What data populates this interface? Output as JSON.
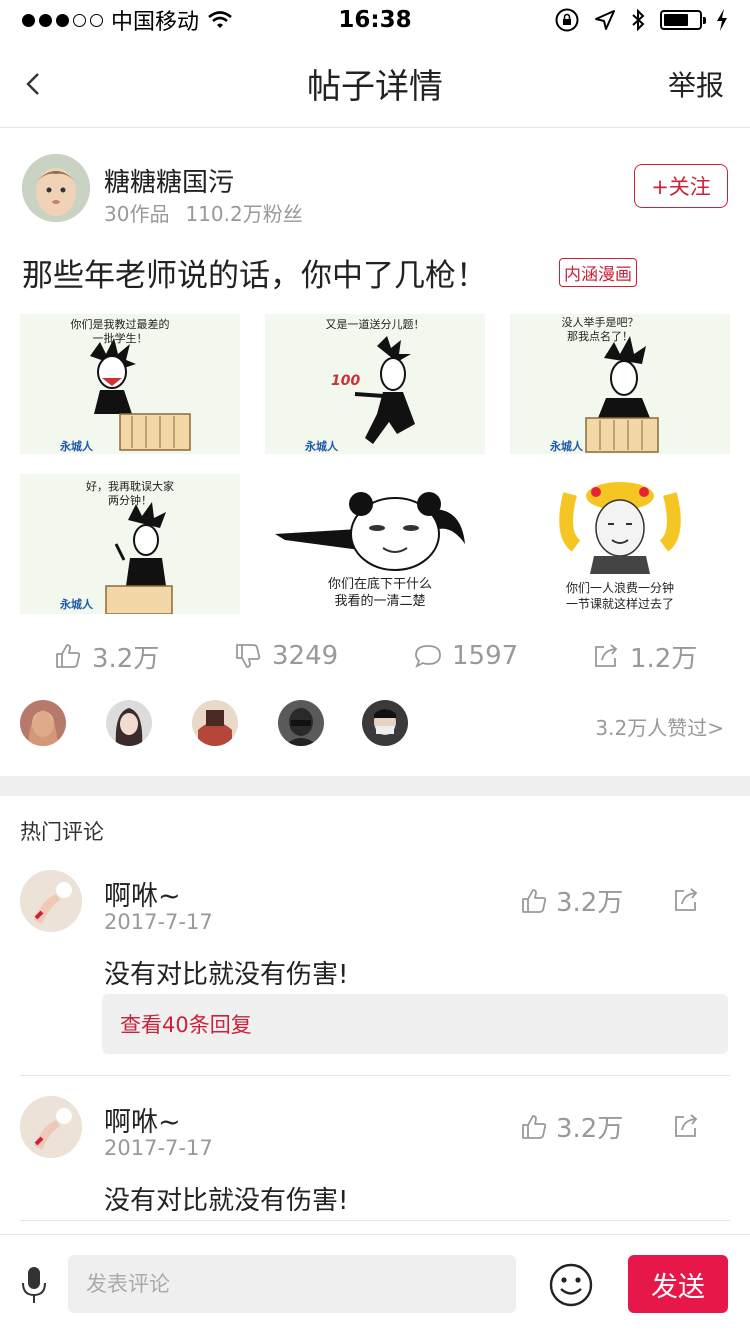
{
  "status": {
    "carrier": "中国移动",
    "time": "16:38",
    "battery_level": 0.7
  },
  "nav": {
    "title": "帖子详情",
    "report": "举报"
  },
  "author": {
    "name": "糖糖糖国污",
    "works": "30作品",
    "fans": "110.2万粉丝",
    "follow": "+关注"
  },
  "post": {
    "title": "那些年老师说的话，你中了几枪！",
    "tag": "内涵漫画",
    "images": [
      {
        "caption": "你们是我教过最差的\n一批学生！",
        "watermark": "永城人"
      },
      {
        "caption": "又是一道送分儿题！",
        "watermark": "永城人",
        "badge": "100"
      },
      {
        "caption": "没人举手是吧？\n那我点名了！",
        "watermark": "永城人"
      },
      {
        "caption": "好，我再耽误大家\n两分钟！",
        "watermark": "永城人"
      },
      {
        "caption": "你们在底下干什么\n我看的一清二楚"
      },
      {
        "caption": "你们一人浪费一分钟\n一节课就这样过去了"
      }
    ]
  },
  "stats": {
    "likes": "3.2万",
    "dislikes": "3249",
    "comments": "1597",
    "shares": "1.2万"
  },
  "likers": {
    "summary": "3.2万人赞过>"
  },
  "hot_comments": {
    "title": "热门评论",
    "items": [
      {
        "name": "啊咻~",
        "date": "2017-7-17",
        "text": "没有对比就没有伤害!",
        "likes": "3.2万",
        "replies": "查看40条回复"
      },
      {
        "name": "啊咻~",
        "date": "2017-7-17",
        "text": "没有对比就没有伤害!",
        "likes": "3.2万"
      }
    ]
  },
  "input_bar": {
    "placeholder": "发表评论",
    "send": "发送"
  },
  "colors": {
    "accent": "#c8233a",
    "send": "#e8174a",
    "muted": "#999999"
  },
  "icons": [
    "back-icon",
    "wifi-icon",
    "lock-rotation-icon",
    "location-icon",
    "bluetooth-icon",
    "battery-icon",
    "thumb-up-icon",
    "thumb-down-icon",
    "comment-icon",
    "share-icon",
    "mic-icon",
    "emoji-icon"
  ]
}
